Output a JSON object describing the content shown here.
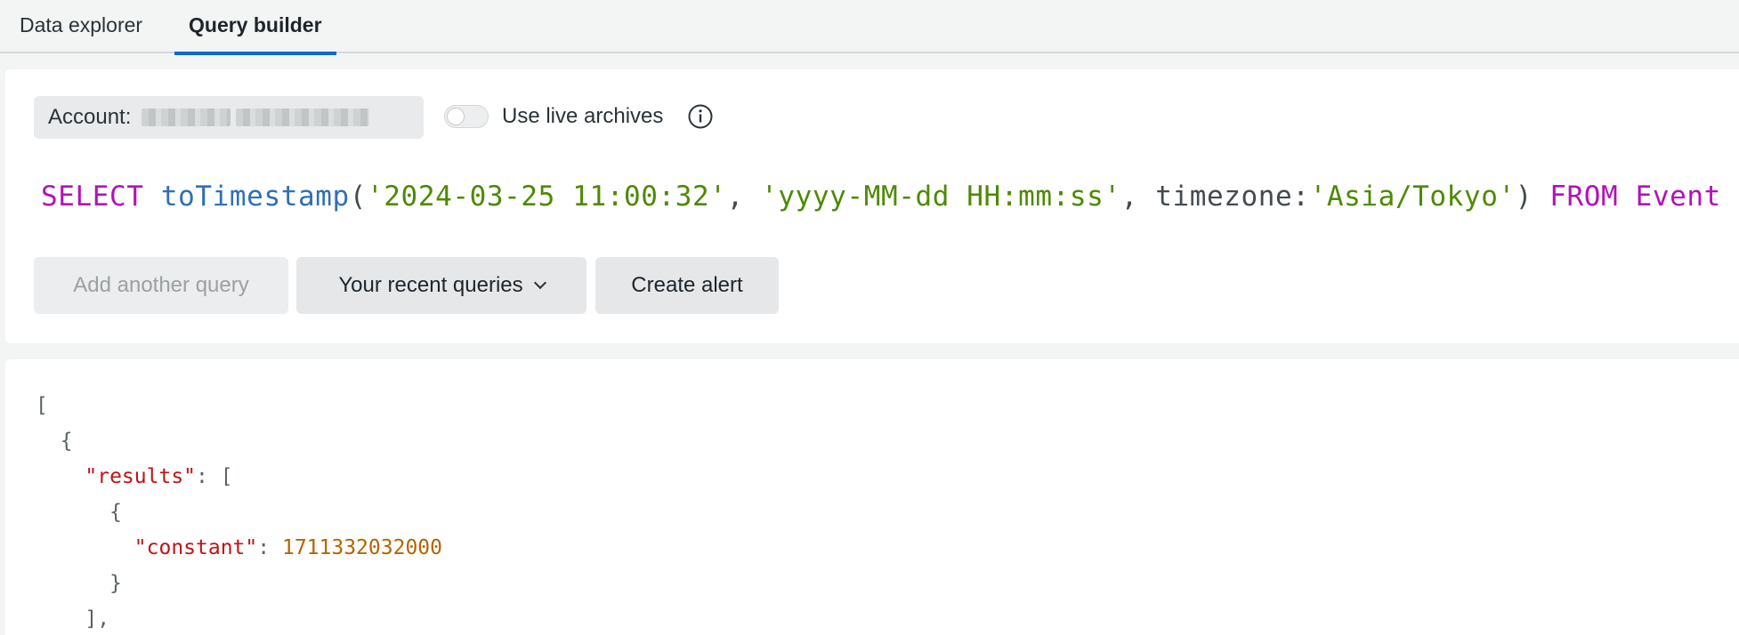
{
  "tabs": [
    {
      "label": "Data explorer",
      "active": false
    },
    {
      "label": "Query builder",
      "active": true
    }
  ],
  "account": {
    "label": "Account:"
  },
  "live_archives": {
    "label": "Use live archives",
    "enabled": false
  },
  "query": {
    "keyword_select": "SELECT",
    "function": "toTimestamp",
    "open_paren": "(",
    "arg1": "'2024-03-25 11:00:32'",
    "comma1": ", ",
    "arg2": "'yyyy-MM-dd HH:mm:ss'",
    "comma2": ", ",
    "param": "timezone:",
    "arg3": "'Asia/Tokyo'",
    "close_paren": ")",
    "keyword_from": "FROM",
    "event": "Event"
  },
  "buttons": {
    "add_query": "Add another query",
    "recent_queries": "Your recent queries",
    "create_alert": "Create alert"
  },
  "results": {
    "open_bracket": "[",
    "open_obj": "{",
    "results_key": "\"results\"",
    "results_colon": ": [",
    "inner_open": "{",
    "constant_key": "\"constant\"",
    "constant_colon": ": ",
    "constant_value": "1711332032000",
    "inner_close": "}",
    "array_close": "],"
  },
  "colors": {
    "accent": "#0b6acb",
    "keyword": "#b311b7",
    "function": "#2f6fb8",
    "string": "#4d8a00",
    "json_key": "#c01313",
    "json_number": "#b46400"
  }
}
